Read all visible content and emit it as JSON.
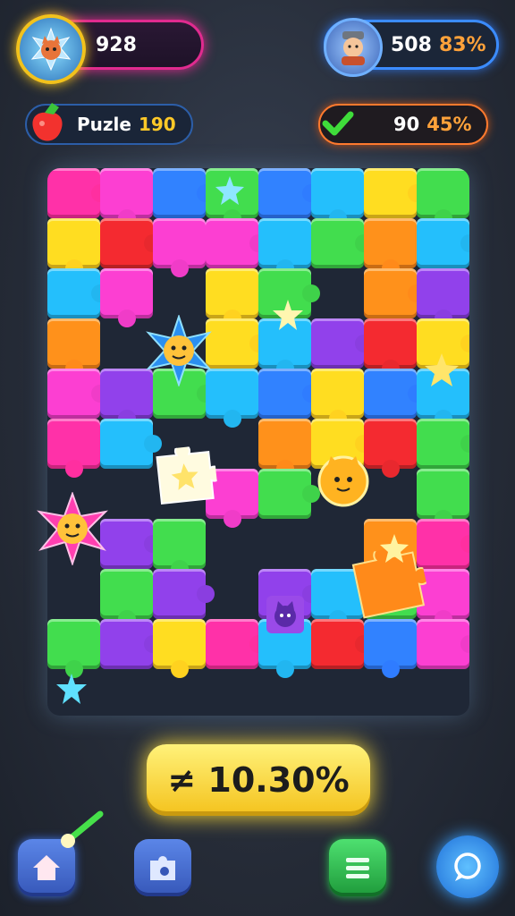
{
  "hud": {
    "score": "928",
    "player_score": "508",
    "player_percent": "83%",
    "puzzle_label": "Puzle",
    "puzzle_number": "190",
    "check_count": "90",
    "check_percent": "45%"
  },
  "progress_label": "≠ 10.30%",
  "colors": {
    "pink": "#ff2fa0",
    "magenta": "#f03cc8",
    "blue": "#2f7cff",
    "cyan": "#22b6f0",
    "green": "#3fd24a",
    "yellow": "#ffd21f",
    "orange": "#ff8a1a",
    "red": "#e8282e",
    "purple": "#8a3ee0"
  },
  "board": {
    "rows": [
      [
        "pink",
        "magenta",
        "blue",
        "green",
        "blue",
        "cyan",
        "yellow",
        "green"
      ],
      [
        "yellow",
        "red",
        "magenta",
        "magenta",
        "cyan",
        "green",
        "orange",
        "cyan"
      ],
      [
        "cyan",
        "magenta",
        "",
        "yellow",
        "green",
        "",
        "orange",
        "purple"
      ],
      [
        "orange",
        "",
        "",
        "yellow",
        "cyan",
        "purple",
        "red",
        "yellow"
      ],
      [
        "magenta",
        "purple",
        "green",
        "cyan",
        "blue",
        "yellow",
        "blue",
        "cyan"
      ],
      [
        "pink",
        "cyan",
        "",
        "",
        "orange",
        "yellow",
        "red",
        "green"
      ],
      [
        "",
        "",
        "",
        "magenta",
        "green",
        "",
        "",
        "green"
      ],
      [
        "",
        "purple",
        "green",
        "",
        "",
        "",
        "orange",
        "pink"
      ],
      [
        "",
        "green",
        "purple",
        "",
        "purple",
        "cyan",
        "green",
        "magenta"
      ],
      [
        "green",
        "purple",
        "yellow",
        "pink",
        "cyan",
        "red",
        "blue",
        "magenta"
      ],
      [
        "",
        "",
        "",
        "",
        "",
        "",
        "",
        ""
      ]
    ]
  },
  "nav": [
    "home-icon",
    "puzzle-piece-icon",
    "list-icon",
    "chat-icon"
  ]
}
